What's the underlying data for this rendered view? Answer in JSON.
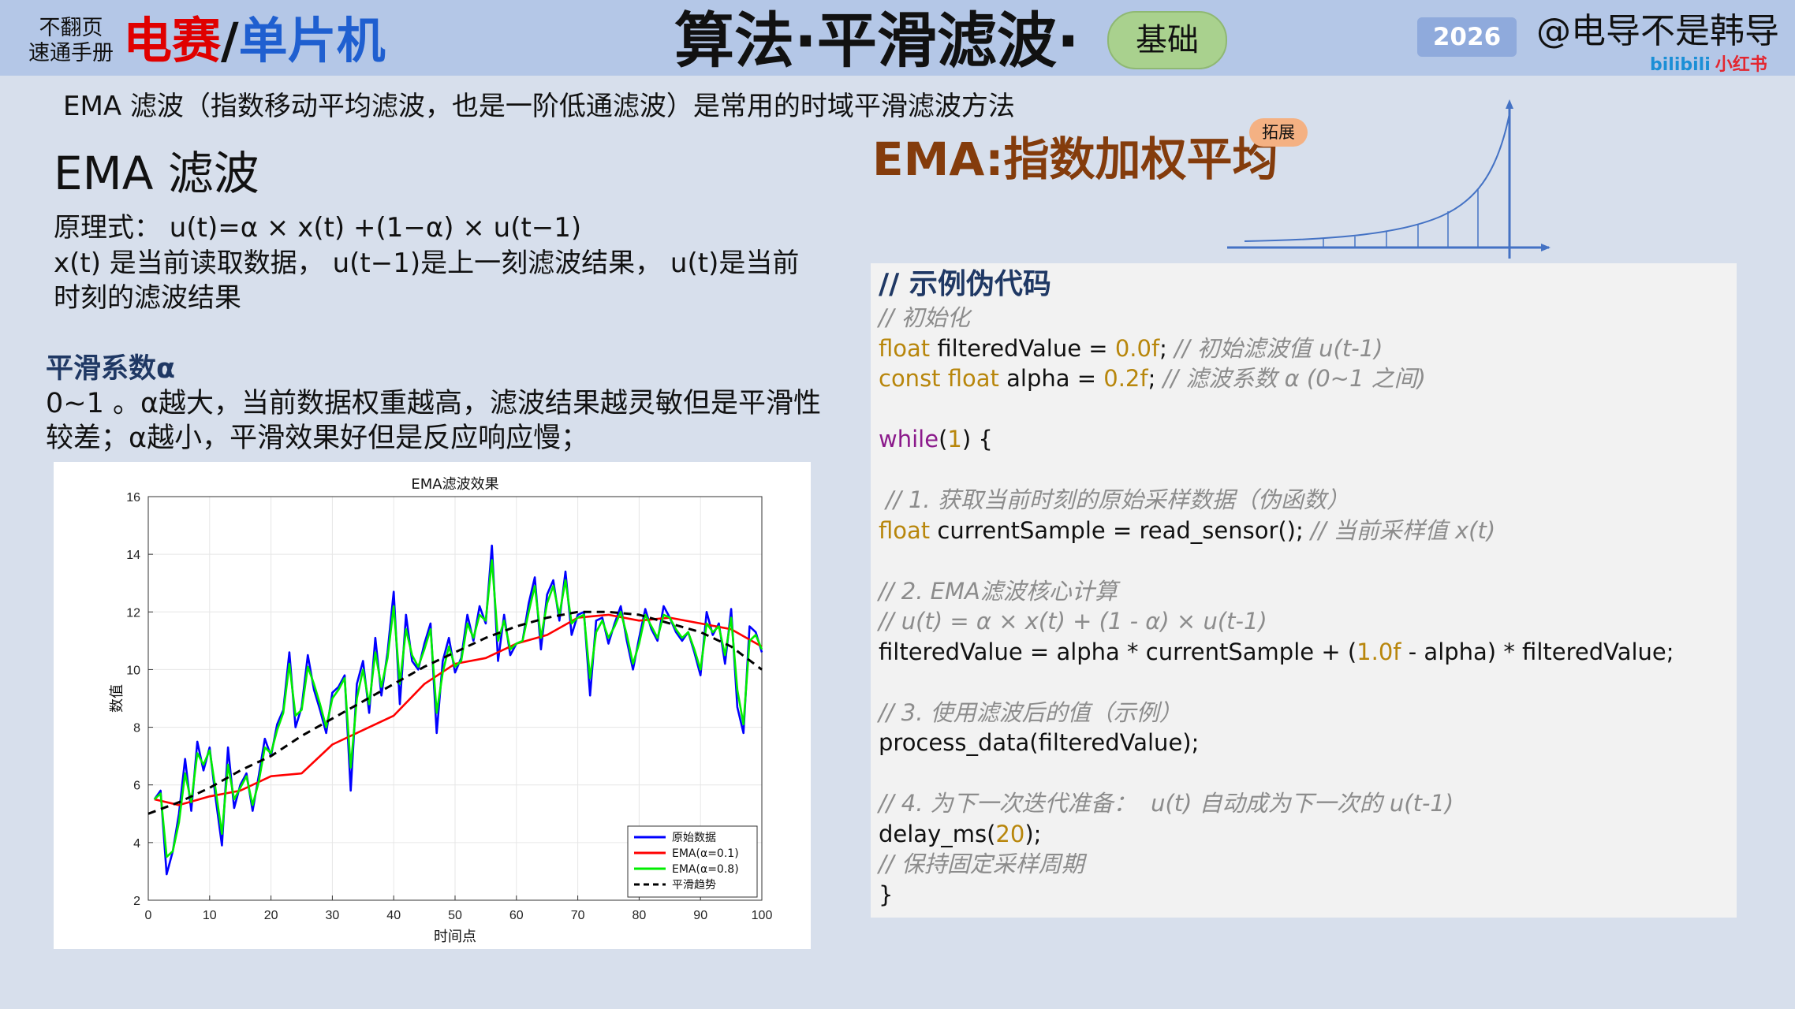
{
  "header": {
    "brand_small_line1": "不翻页",
    "brand_small_line2": "速通手册",
    "brand_red": "电赛",
    "brand_slash": "/",
    "brand_blue": "单片机",
    "title": "算法·平滑滤波·",
    "level": "基础",
    "year": "2026",
    "author": "@电导不是韩导",
    "platform_bili": "bilibili",
    "platform_xhs": "小红书"
  },
  "intro": "EMA 滤波（指数移动平均滤波，也是一阶低通滤波）是常用的时域平滑滤波方法",
  "ema_section": {
    "heading": "EMA 滤波",
    "formula": "原理式：  u(t)=α × x(t) +(1−α) × u(t−1)",
    "explain": "x(t) 是当前读取数据，  u(t−1)是上一刻滤波结果，  u(t)是当前时刻的滤波结果"
  },
  "alpha_section": {
    "heading": "平滑系数α",
    "text": "0~1 。α越大，当前数据权重越高，滤波结果越灵敏但是平滑性较差；α越小，平滑效果好但是反应响应慢；"
  },
  "right": {
    "title": "EMA:指数加权平均",
    "badge": "拓展"
  },
  "colors": {
    "header_bg": "#b4c7e7",
    "page_bg": "#d7dfec",
    "brand_red": "#e00000",
    "brand_blue": "#1f5fd0",
    "ema_title": "#843c0c",
    "code_keyword": "#b8860b",
    "code_comment": "#8c8c8c",
    "code_while": "#8b1a8b"
  },
  "code": {
    "heading": "// 示例伪代码",
    "lines": [
      [
        {
          "t": "cm",
          "s": "// 初始化"
        }
      ],
      [
        {
          "t": "kw",
          "s": "float"
        },
        {
          "t": "plain",
          "s": " filteredValue = "
        },
        {
          "t": "num",
          "s": "0.0f"
        },
        {
          "t": "plain",
          "s": "; "
        },
        {
          "t": "cm",
          "s": "// 初始滤波值 u(t-1)"
        }
      ],
      [
        {
          "t": "kw",
          "s": "const float"
        },
        {
          "t": "plain",
          "s": " alpha = "
        },
        {
          "t": "num",
          "s": "0.2f"
        },
        {
          "t": "plain",
          "s": "; "
        },
        {
          "t": "cm",
          "s": "// 滤波系数 α (0~1 之间)"
        }
      ],
      [],
      [
        {
          "t": "wh",
          "s": "while"
        },
        {
          "t": "plain",
          "s": "("
        },
        {
          "t": "num",
          "s": "1"
        },
        {
          "t": "plain",
          "s": ") {"
        }
      ],
      [],
      [
        {
          "t": "cm",
          "s": " // 1. 获取当前时刻的原始采样数据（伪函数）"
        }
      ],
      [
        {
          "t": "kw",
          "s": "float"
        },
        {
          "t": "plain",
          "s": " currentSample = read_sensor(); "
        },
        {
          "t": "cm",
          "s": "// 当前采样值 x(t)"
        }
      ],
      [],
      [
        {
          "t": "cm",
          "s": "// 2. EMA滤波核心计算"
        }
      ],
      [
        {
          "t": "cm",
          "s": "// u(t) = α × x(t) + (1 - α) × u(t-1)"
        }
      ],
      [
        {
          "t": "plain",
          "s": "filteredValue = alpha * currentSample + ("
        },
        {
          "t": "num",
          "s": "1.0f"
        },
        {
          "t": "plain",
          "s": " - alpha) * filteredValue;"
        }
      ],
      [],
      [
        {
          "t": "cm",
          "s": "// 3. 使用滤波后的值（示例）"
        }
      ],
      [
        {
          "t": "plain",
          "s": "process_data(filteredValue);"
        }
      ],
      [],
      [
        {
          "t": "cm",
          "s": "// 4. 为下一次迭代准备：  u(t) 自动成为下一次的 u(t-1)"
        }
      ],
      [
        {
          "t": "plain",
          "s": "delay_ms("
        },
        {
          "t": "num",
          "s": "20"
        },
        {
          "t": "plain",
          "s": ");"
        }
      ],
      [
        {
          "t": "cm",
          "s": "// 保持固定采样周期"
        }
      ],
      [
        {
          "t": "plain",
          "s": "}"
        }
      ]
    ]
  },
  "chart_data": {
    "type": "line",
    "title": "EMA滤波效果",
    "xlabel": "时间点",
    "ylabel": "数值",
    "xlim": [
      0,
      100
    ],
    "ylim": [
      2,
      16
    ],
    "xticks": [
      0,
      10,
      20,
      30,
      40,
      50,
      60,
      70,
      80,
      90,
      100
    ],
    "yticks": [
      2,
      4,
      6,
      8,
      10,
      12,
      14,
      16
    ],
    "grid": true,
    "legend_position": "bottom-right",
    "legend": [
      "原始数据",
      "EMA(α=0.1)",
      "EMA(α=0.8)",
      "平滑趋势"
    ],
    "series": [
      {
        "name": "原始数据",
        "color": "#0000ff",
        "dash": false,
        "x": [
          1,
          2,
          3,
          4,
          5,
          6,
          7,
          8,
          9,
          10,
          11,
          12,
          13,
          14,
          15,
          16,
          17,
          18,
          19,
          20,
          21,
          22,
          23,
          24,
          25,
          26,
          27,
          28,
          29,
          30,
          31,
          32,
          33,
          34,
          35,
          36,
          37,
          38,
          39,
          40,
          41,
          42,
          43,
          44,
          45,
          46,
          47,
          48,
          49,
          50,
          51,
          52,
          53,
          54,
          55,
          56,
          57,
          58,
          59,
          60,
          61,
          62,
          63,
          64,
          65,
          66,
          67,
          68,
          69,
          70,
          71,
          72,
          73,
          74,
          75,
          76,
          77,
          78,
          79,
          80,
          81,
          82,
          83,
          84,
          85,
          86,
          87,
          88,
          89,
          90,
          91,
          92,
          93,
          94,
          95,
          96,
          97,
          98,
          99,
          100
        ],
        "y": [
          5.5,
          5.8,
          2.9,
          3.7,
          5.0,
          6.9,
          5.1,
          7.5,
          6.5,
          7.3,
          5.5,
          3.9,
          7.3,
          5.2,
          6.0,
          6.4,
          5.1,
          6.3,
          7.6,
          7.0,
          8.1,
          8.6,
          10.6,
          8.0,
          8.7,
          10.5,
          9.3,
          8.6,
          7.8,
          9.2,
          9.4,
          9.8,
          5.8,
          9.5,
          10.3,
          8.5,
          11.1,
          9.1,
          10.6,
          12.7,
          8.8,
          11.9,
          10.3,
          10.0,
          10.9,
          11.6,
          7.8,
          10.3,
          11.1,
          9.9,
          10.4,
          11.9,
          11.0,
          12.2,
          11.6,
          14.3,
          10.3,
          11.9,
          10.5,
          10.9,
          11.0,
          12.3,
          13.2,
          10.7,
          12.6,
          13.1,
          11.7,
          13.4,
          11.2,
          11.9,
          12.0,
          9.1,
          11.7,
          11.8,
          10.9,
          11.6,
          12.2,
          11.0,
          10.0,
          11.1,
          12.1,
          11.4,
          11.0,
          12.2,
          11.8,
          11.3,
          11.0,
          11.3,
          10.6,
          9.8,
          12.0,
          11.2,
          11.6,
          10.2,
          12.1,
          8.7,
          7.8,
          11.5,
          11.3,
          10.6
        ]
      },
      {
        "name": "EMA(α=0.1)",
        "color": "#ff0000",
        "dash": false,
        "x": [
          1,
          5,
          10,
          15,
          20,
          25,
          30,
          35,
          40,
          45,
          50,
          55,
          60,
          65,
          70,
          75,
          80,
          85,
          90,
          95,
          100
        ],
        "y": [
          5.5,
          5.3,
          5.6,
          5.8,
          6.3,
          6.4,
          7.4,
          7.9,
          8.4,
          9.5,
          10.2,
          10.4,
          10.9,
          11.2,
          11.8,
          11.9,
          11.7,
          11.8,
          11.6,
          11.4,
          10.8
        ]
      },
      {
        "name": "EMA(α=0.8)",
        "color": "#00ee00",
        "dash": false,
        "x": [
          1,
          2,
          3,
          4,
          5,
          6,
          7,
          8,
          9,
          10,
          11,
          12,
          13,
          14,
          15,
          16,
          17,
          18,
          19,
          20,
          21,
          22,
          23,
          24,
          25,
          26,
          27,
          28,
          29,
          30,
          31,
          32,
          33,
          34,
          35,
          36,
          37,
          38,
          39,
          40,
          41,
          42,
          43,
          44,
          45,
          46,
          47,
          48,
          49,
          50,
          51,
          52,
          53,
          54,
          55,
          56,
          57,
          58,
          59,
          60,
          61,
          62,
          63,
          64,
          65,
          66,
          67,
          68,
          69,
          70,
          71,
          72,
          73,
          74,
          75,
          76,
          77,
          78,
          79,
          80,
          81,
          82,
          83,
          84,
          85,
          86,
          87,
          88,
          89,
          90,
          91,
          92,
          93,
          94,
          95,
          96,
          97,
          98,
          99,
          100
        ],
        "y": [
          5.5,
          5.7,
          3.5,
          3.7,
          4.7,
          6.4,
          5.4,
          7.1,
          6.7,
          7.2,
          5.8,
          4.3,
          6.7,
          5.5,
          5.9,
          6.3,
          5.3,
          6.1,
          7.3,
          7.1,
          7.9,
          8.5,
          10.2,
          8.4,
          8.6,
          10.1,
          9.5,
          8.8,
          8.0,
          9.0,
          9.3,
          9.7,
          6.6,
          9.0,
          10.0,
          8.8,
          10.6,
          9.4,
          10.4,
          12.2,
          9.5,
          11.4,
          10.5,
          10.1,
          10.7,
          11.4,
          8.5,
          9.9,
          10.8,
          10.1,
          10.3,
          11.6,
          11.1,
          11.9,
          11.7,
          13.8,
          11.0,
          11.7,
          10.7,
          10.9,
          11.0,
          12.0,
          12.9,
          11.1,
          12.3,
          12.9,
          11.9,
          13.1,
          11.6,
          11.8,
          11.9,
          9.7,
          11.3,
          11.7,
          11.1,
          11.5,
          12.0,
          11.2,
          10.2,
          10.9,
          11.9,
          11.5,
          11.1,
          11.9,
          11.8,
          11.4,
          11.1,
          11.3,
          10.7,
          10.0,
          11.6,
          11.3,
          11.5,
          10.5,
          11.8,
          9.3,
          8.1,
          11.0,
          11.2,
          10.7
        ]
      },
      {
        "name": "平滑趋势",
        "color": "#000000",
        "dash": true,
        "x": [
          0,
          5,
          10,
          15,
          20,
          25,
          30,
          35,
          40,
          45,
          50,
          55,
          60,
          65,
          70,
          75,
          80,
          85,
          90,
          95,
          100
        ],
        "y": [
          5.0,
          5.4,
          5.9,
          6.5,
          7.0,
          7.7,
          8.3,
          8.9,
          9.5,
          10.1,
          10.6,
          11.1,
          11.5,
          11.8,
          12.0,
          12.0,
          11.9,
          11.6,
          11.3,
          10.8,
          10.0
        ]
      }
    ]
  }
}
